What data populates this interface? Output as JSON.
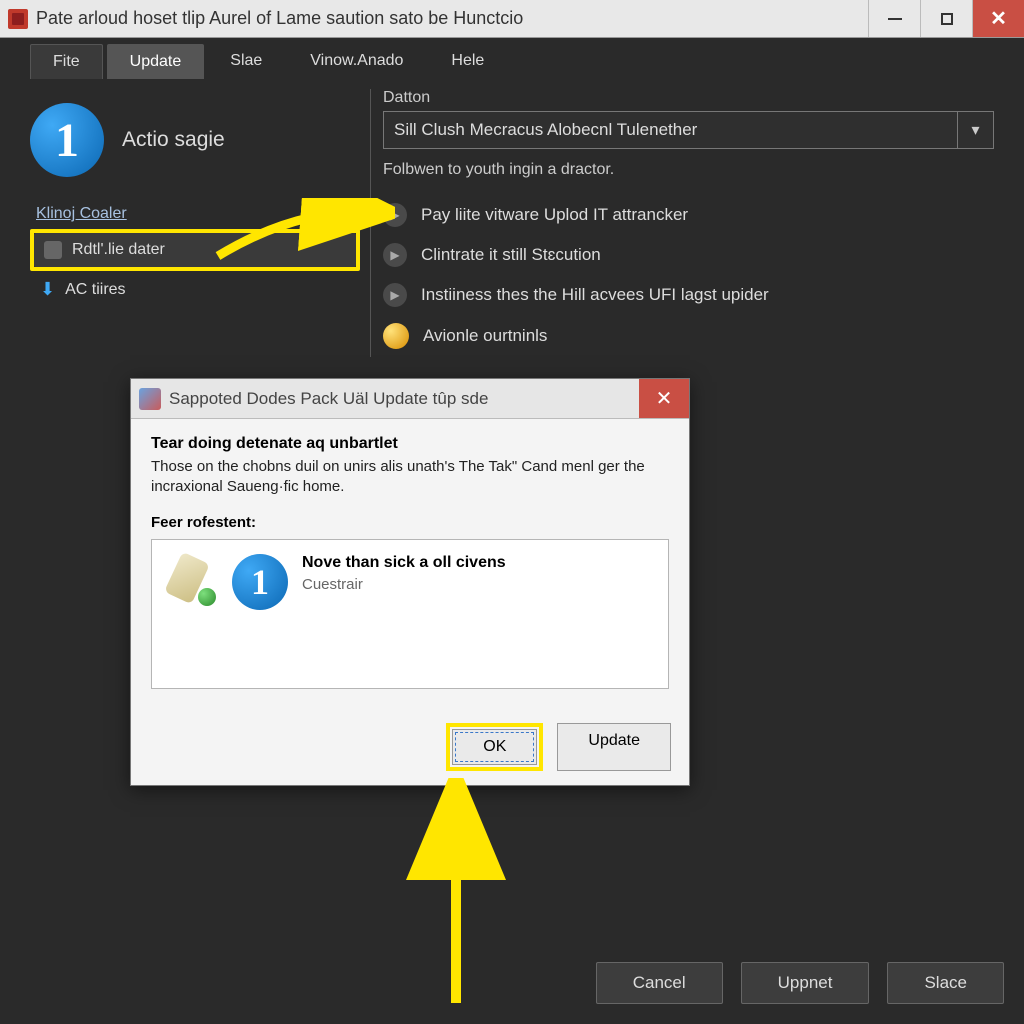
{
  "window": {
    "title": "Pate arloud hoset tlip Aurel of Lame saution sato be Hunctcio"
  },
  "tabs": {
    "file": "Fite",
    "update": "Update",
    "slae": "Slae",
    "vinow": "Vinow.Anado",
    "hele": "Hele"
  },
  "left": {
    "badge_number": "1",
    "stage_label": "Actio sagie",
    "subhead": "Klinoj Coaler",
    "item1": "Rdtl'.lie dater",
    "item2": "AC tiires"
  },
  "right": {
    "field_label": "Datton",
    "dropdown_value": "Sill Clush Mecracus Alobecnl Tulenether",
    "helper": "Folbwen to youth ingin a dractor.",
    "steps": {
      "s1": "Pay liite vitware Uplod IT attrancker",
      "s2": "Clintrate it still Stɛcution",
      "s3": "Instiiness thes the Hill acvees UFI lagst upider",
      "s4": "Avionle ourtninls"
    }
  },
  "modal": {
    "title": "Sappoted Dodes Pack Uäl Update tûp sde",
    "heading": "Tear doing detenate aq unbartlet",
    "body": "Those on the chobns duil on unirs alis unath's The Tak\" Cand menl ger the incraxional Saueng·fic home.",
    "sub": "Feer rofestent:",
    "item_badge": "1",
    "item_title": "Nove than sick a oll civens",
    "item_sub": "Cuestrair",
    "ok": "OK",
    "update": "Update"
  },
  "footer": {
    "cancel": "Cancel",
    "uppnet": "Uppnet",
    "slace": "Slace"
  }
}
